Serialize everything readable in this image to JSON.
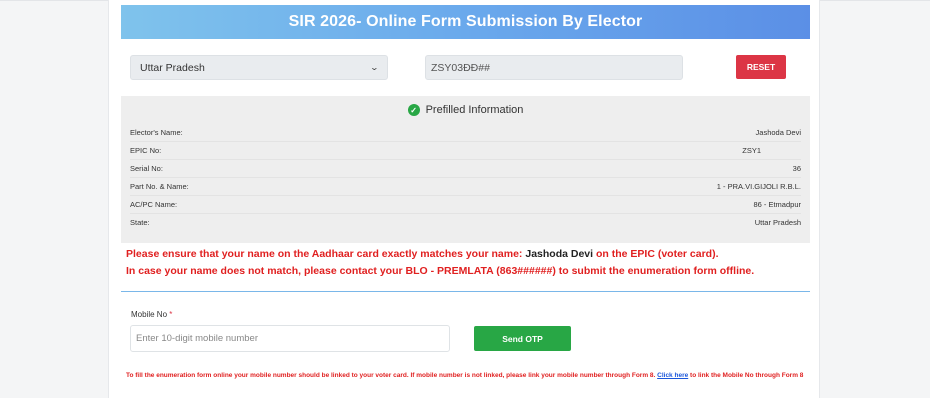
{
  "header": {
    "title": "SIR 2026- Online Form Submission By Elector"
  },
  "filters": {
    "state_selected": "Uttar Pradesh",
    "epic_value": "ZSY03ĐĐ##",
    "reset_label": "RESET"
  },
  "prefill": {
    "title": "Prefilled Information",
    "rows": [
      {
        "label": "Elector's Name:",
        "value": "Jashoda Devi"
      },
      {
        "label": "EPIC No:",
        "value": "ZSY1"
      },
      {
        "label": "Serial No:",
        "value": "36"
      },
      {
        "label": "Part No. & Name:",
        "value": "1 - PRA.VI.GIJOLI R.B.L."
      },
      {
        "label": "AC/PC Name:",
        "value": "86 - Etmadpur"
      },
      {
        "label": "State:",
        "value": "Uttar Pradesh"
      }
    ]
  },
  "notice": {
    "line1_prefix": "Please ensure that your name on the Aadhaar card exactly matches your name:",
    "line1_name": "Jashoda Devi",
    "line1_suffix": "on the EPIC (voter card).",
    "line2": "In case your name does not match, please contact your BLO - PREMLATA (863######) to submit the enumeration form offline."
  },
  "mobile": {
    "label": "Mobile No",
    "required_mark": "*",
    "placeholder": "Enter 10-digit mobile number",
    "otp_label": "Send OTP"
  },
  "footnote": {
    "text_before": "To fill the enumeration form online your mobile number should be linked to your voter card. If mobile number is not linked, please link your mobile number through Form 8.",
    "link": "Click here",
    "text_after": "to link the Mobile No through Form 8"
  },
  "colors": {
    "header_gradient_start": "#7fc3ec",
    "header_gradient_end": "#5b8fe6",
    "reset": "#dc3545",
    "otp": "#28a745",
    "notice_text": "#e02020"
  }
}
